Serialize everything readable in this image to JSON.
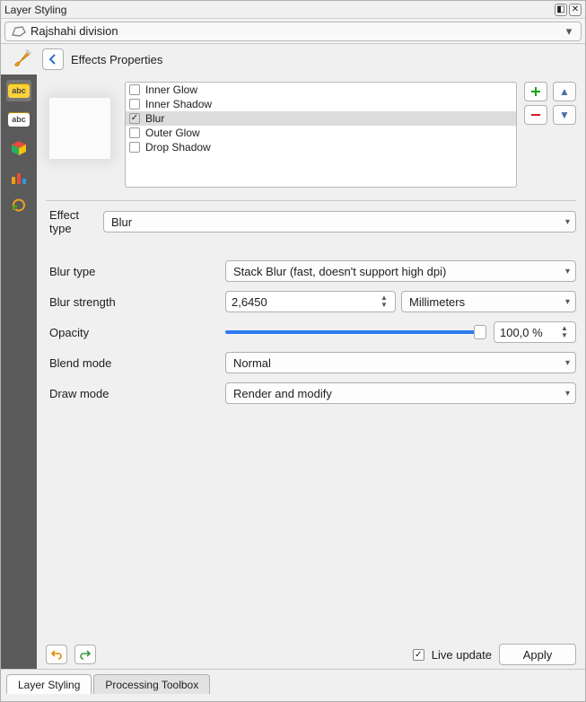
{
  "window": {
    "title": "Layer Styling"
  },
  "layer": {
    "selected": "Rajshahi division"
  },
  "header": {
    "title": "Effects Properties"
  },
  "sidebar_icons": [
    "abc-yellow",
    "abc-white",
    "cube",
    "histogram",
    "refresh"
  ],
  "effects": {
    "items": [
      {
        "label": "Inner Glow",
        "checked": false
      },
      {
        "label": "Inner Shadow",
        "checked": false
      },
      {
        "label": "Blur",
        "checked": true
      },
      {
        "label": "Outer Glow",
        "checked": false
      },
      {
        "label": "Drop Shadow",
        "checked": false
      }
    ],
    "selected_index": 2
  },
  "side_buttons": {
    "add": "+",
    "up": "▲",
    "remove": "−",
    "down": "▼"
  },
  "form": {
    "effect_type_label": "Effect type",
    "effect_type_value": "Blur",
    "blur_type_label": "Blur type",
    "blur_type_value": "Stack Blur (fast, doesn't support high dpi)",
    "blur_strength_label": "Blur strength",
    "blur_strength_value": "2,6450",
    "blur_strength_unit": "Millimeters",
    "opacity_label": "Opacity",
    "opacity_percent": "100,0 %",
    "blend_mode_label": "Blend mode",
    "blend_mode_value": "Normal",
    "draw_mode_label": "Draw mode",
    "draw_mode_value": "Render and modify"
  },
  "footer": {
    "live_update_label": "Live update",
    "live_update_checked": true,
    "apply_label": "Apply"
  },
  "dock": {
    "tabs": [
      "Layer Styling",
      "Processing Toolbox"
    ],
    "active_index": 1
  },
  "colors": {
    "accent": "#2d7bf0"
  }
}
